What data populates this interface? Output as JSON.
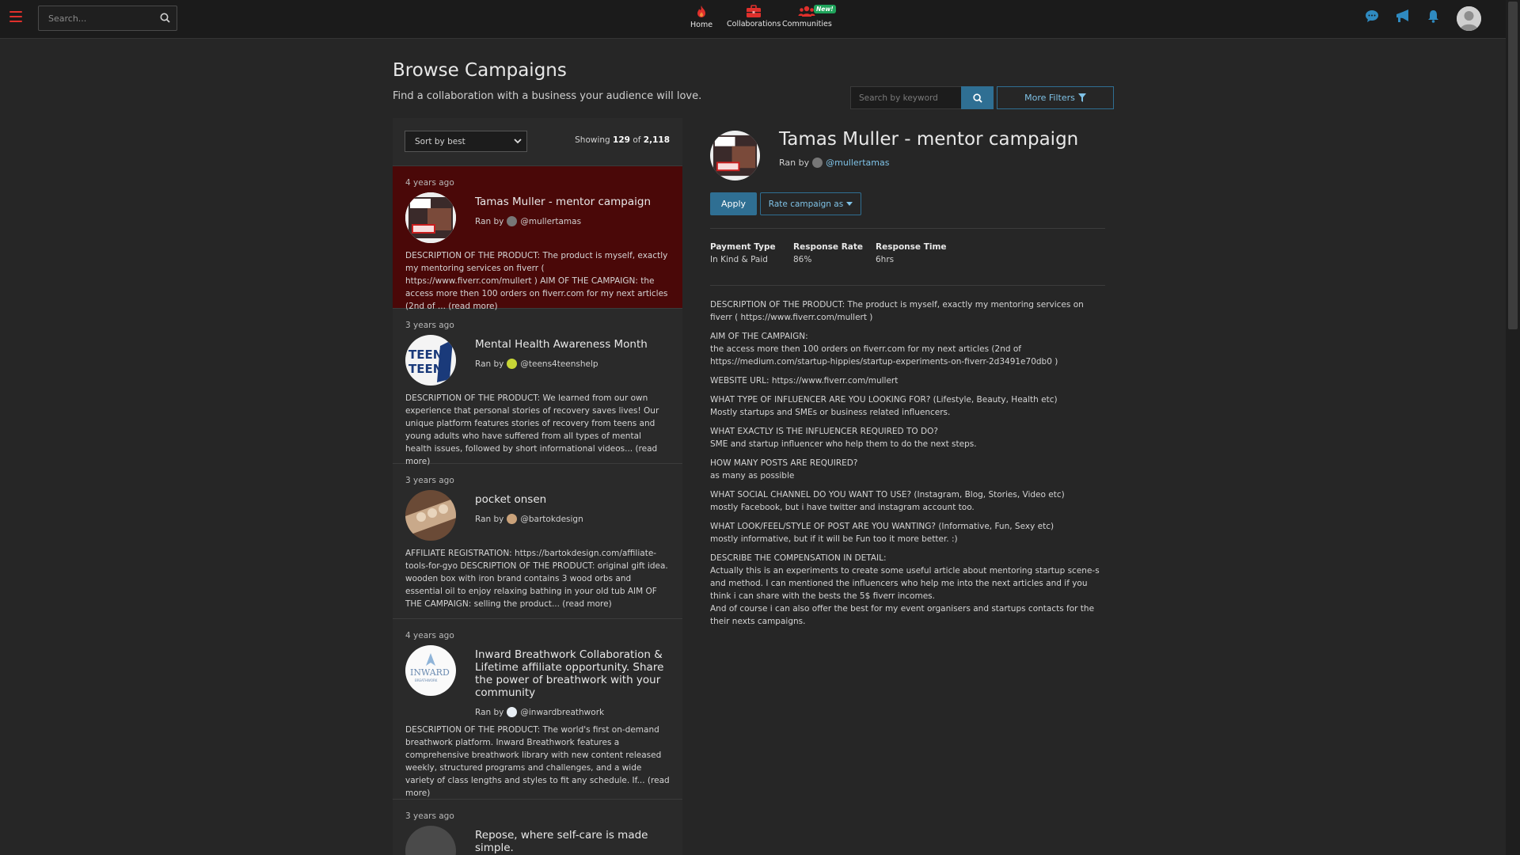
{
  "topbar": {
    "search_placeholder": "Search...",
    "nav": [
      {
        "label": "Home",
        "icon": "flame-icon"
      },
      {
        "label": "Collaborations",
        "icon": "briefcase-icon"
      },
      {
        "label": "Communities",
        "icon": "people-icon",
        "badge": "New!"
      }
    ]
  },
  "header": {
    "title": "Browse Campaigns",
    "subtitle": "Find a collaboration with a business your audience will love.",
    "keyword_placeholder": "Search by keyword",
    "more_filters": "More Filters"
  },
  "list": {
    "sort_label": "Sort by best",
    "showing_prefix": "Showing",
    "showing_count": "129",
    "showing_of": "of",
    "showing_total": "2,118",
    "campaigns": [
      {
        "ago": "4 years ago",
        "title": "Tamas Muller - mentor campaign",
        "ran_by": "Ran by",
        "handle": "@mullertamas",
        "desc": "DESCRIPTION OF THE PRODUCT: The product is myself, exactly my mentoring services on fiverr ( https://www.fiverr.com/mullert ) AIM OF THE CAMPAIGN: the access more then 100 orders on fiverr.com for my next articles (2nd of ... (read more)"
      },
      {
        "ago": "3 years ago",
        "title": "Mental Health Awareness Month",
        "ran_by": "Ran by",
        "handle": "@teens4teenshelp",
        "desc": "DESCRIPTION OF THE PRODUCT: We learned from our own experience that personal stories of recovery saves lives! Our unique platform features stories of recovery from teens and young adults who have suffered from all types of mental health issues, followed by short informational videos... (read more)"
      },
      {
        "ago": "3 years ago",
        "title": "pocket onsen",
        "ran_by": "Ran by",
        "handle": "@bartokdesign",
        "desc": "AFFILIATE REGISTRATION: https://bartokdesign.com/affiliate-tools-for-gyo DESCRIPTION OF THE PRODUCT: original gift idea. wooden box with iron brand contains 3 wood orbs and essential oil to enjoy relaxing bathing in your old tub AIM OF THE CAMPAIGN: selling the product... (read more)"
      },
      {
        "ago": "4 years ago",
        "title": "Inward Breathwork Collaboration & Lifetime affiliate opportunity. Share the power of breathwork with your community",
        "ran_by": "Ran by",
        "handle": "@inwardbreathwork",
        "desc": "DESCRIPTION OF THE PRODUCT: The world's first on-demand breathwork platform. Inward Breathwork features a comprehensive breathwork library with new content released weekly, structured programs and challenges, and a wide variety of class lengths and styles to fit any schedule. If... (read more)"
      },
      {
        "ago": "3 years ago",
        "title": "Repose, where self-care is made simple.",
        "ran_by": "",
        "handle": "",
        "desc": ""
      }
    ]
  },
  "detail": {
    "title": "Tamas Muller - mentor campaign",
    "ran_by": "Ran by",
    "handle": "@mullertamas",
    "apply": "Apply",
    "rate": "Rate campaign as",
    "stats": [
      {
        "label": "Payment Type",
        "value": "In Kind & Paid"
      },
      {
        "label": "Response Rate",
        "value": "86%"
      },
      {
        "label": "Response Time",
        "value": "6hrs"
      }
    ],
    "body": [
      "DESCRIPTION OF THE PRODUCT: The product is myself, exactly my mentoring services on fiverr ( https://www.fiverr.com/mullert )",
      "AIM OF THE CAMPAIGN:\nthe access more then 100 orders on fiverr.com for my next articles (2nd of\nhttps://medium.com/startup-hippies/startup-experiments-on-fiverr-2d3491e70db0 )",
      "WEBSITE URL: https://www.fiverr.com/mullert",
      "WHAT TYPE OF INFLUENCER ARE YOU LOOKING FOR? (Lifestyle, Beauty, Health etc)\nMostly startups and SMEs or business related influencers.",
      "WHAT EXACTLY IS THE INFLUENCER REQUIRED TO DO?\nSME and startup influencer who help them to do the next steps.",
      "HOW MANY POSTS ARE REQUIRED?\nas many as possible",
      "WHAT SOCIAL CHANNEL DO YOU WANT TO USE? (Instagram, Blog, Stories, Video etc)\nmostly Facebook, but i have twitter and instagram account too.",
      "WHAT LOOK/FEEL/STYLE OF POST ARE YOU WANTING? (Informative, Fun, Sexy etc)\nmostly informative, but if it will be Fun too it more better. :)",
      "DESCRIBE THE COMPENSATION IN DETAIL:\nActually this is an experiments to create some useful article about mentoring startup scene-s and method. I can mentioned the influencers who help me into the next articles and if you think i can share with the bests the 5$ fiverr incomes.\nAnd of course i can also offer the best for my event organisers and startups contacts for the their nexts campaigns."
    ]
  },
  "colors": {
    "accent": "#2f6f93",
    "active_row": "#4a0808",
    "brand_red": "#e0302c"
  }
}
